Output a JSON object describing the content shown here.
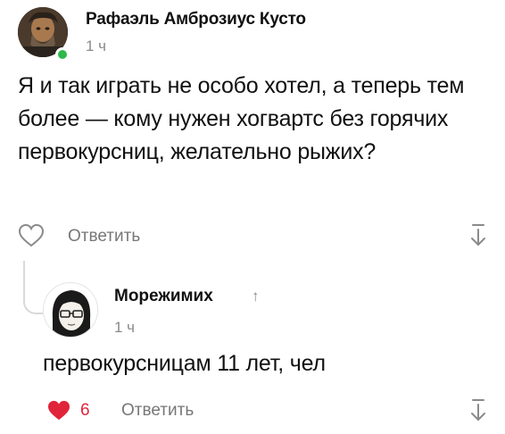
{
  "comment": {
    "author": "Рафаэль Амброзиус Кусто",
    "time": "1 ч",
    "text": "Я и так играть не особо хотел, а теперь тем более — кому нужен хогвартс без горячих первокурсниц, желательно рыжих?",
    "reply_label": "Ответить",
    "like_icon": "heart-outline-icon",
    "collapse_icon": "collapse-thread-icon",
    "online_color": "#2eb84a"
  },
  "reply": {
    "author": "Морежимих",
    "reply_marker": "↑",
    "time": "1 ч",
    "text": "первокурсницам 11 лет, чел",
    "likes": "6",
    "reply_label": "Ответить",
    "like_icon": "heart-filled-icon",
    "like_color": "#e0243a",
    "collapse_icon": "collapse-thread-icon"
  }
}
